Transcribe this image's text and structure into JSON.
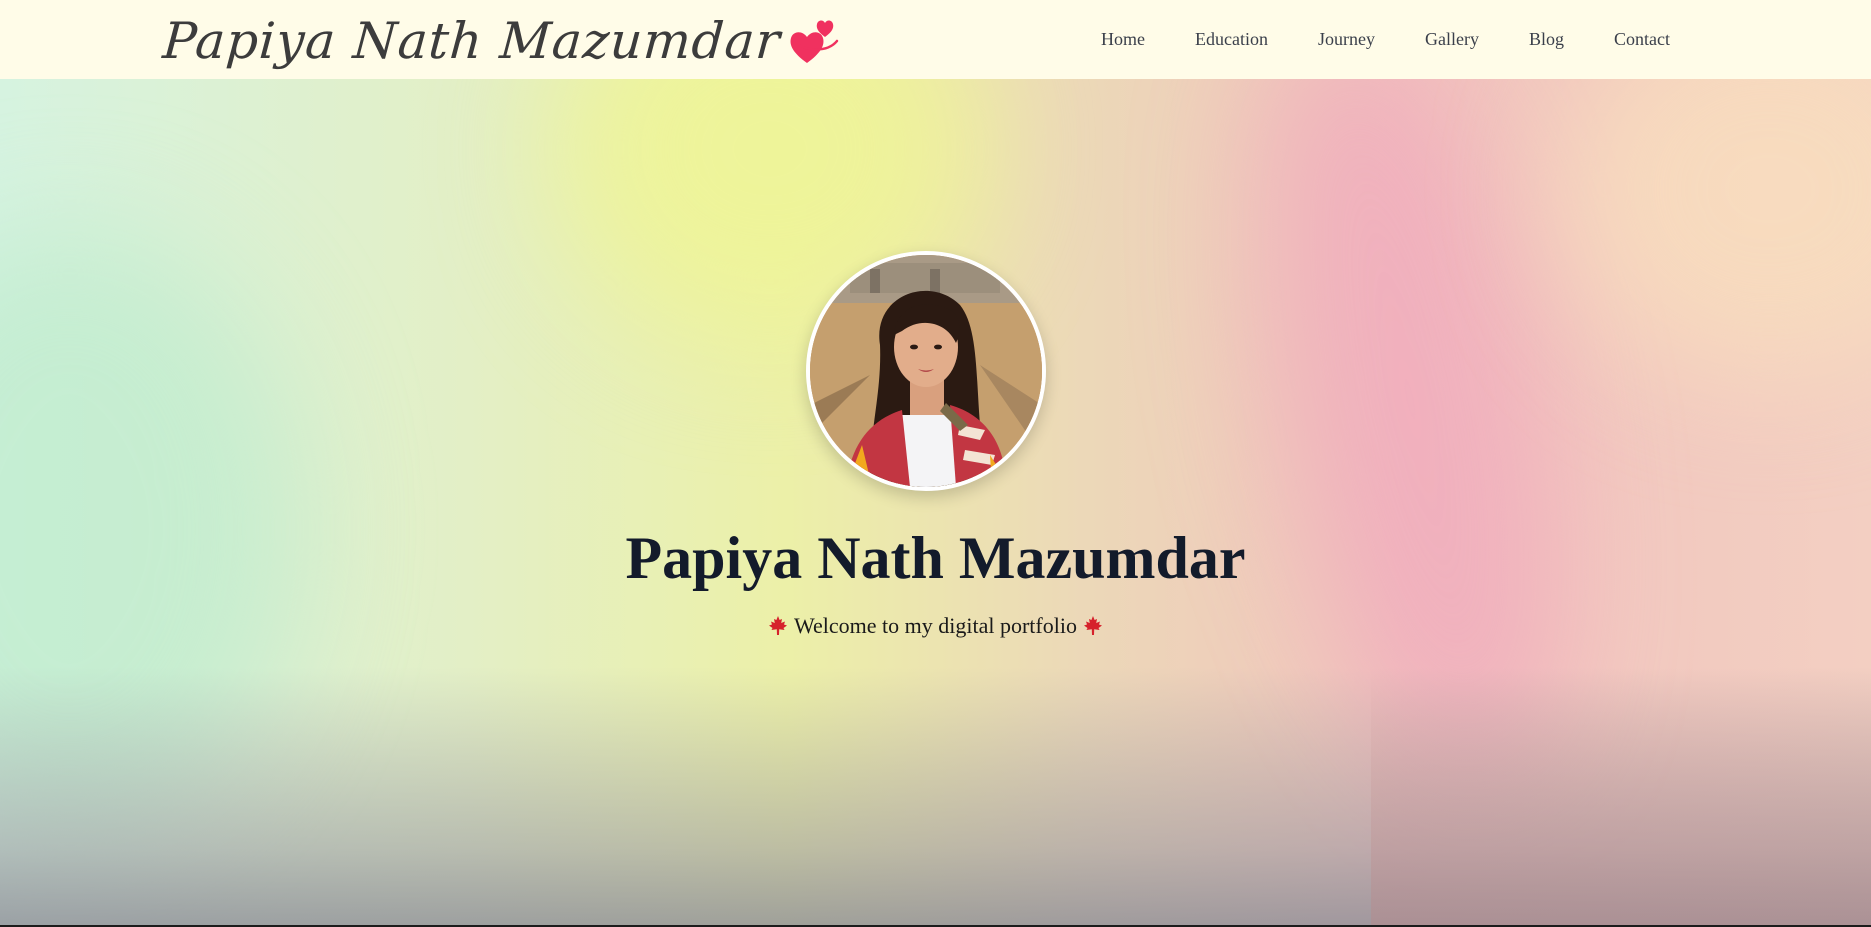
{
  "header": {
    "brand": "Papiya Nath Mazumdar",
    "brand_icon": "double-heart-icon",
    "nav": [
      {
        "label": "Home"
      },
      {
        "label": "Education"
      },
      {
        "label": "Journey"
      },
      {
        "label": "Gallery"
      },
      {
        "label": "Blog"
      },
      {
        "label": "Contact"
      }
    ]
  },
  "hero": {
    "title": "Papiya Nath Mazumdar",
    "subtitle": "Welcome to my digital portfolio",
    "subtitle_icon": "maple-leaf-icon"
  },
  "colors": {
    "nav_bg": "#fffce8",
    "title": "#131b2b",
    "heart": "#f0315f",
    "leaf": "#d6222c"
  }
}
